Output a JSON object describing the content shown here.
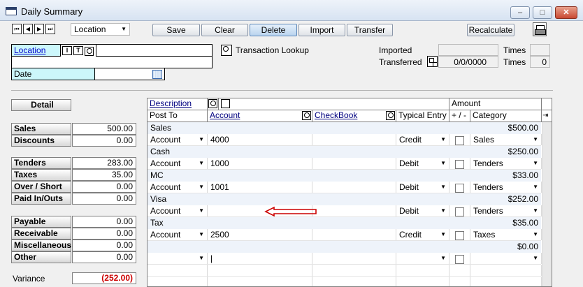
{
  "window": {
    "title": "Daily Summary",
    "min": "–",
    "max": "□",
    "close": "✕"
  },
  "toolbar": {
    "nav": [
      "⏮",
      "◀",
      "▶",
      "⏭"
    ],
    "view_select": "Location",
    "buttons": {
      "save": "Save",
      "clear": "Clear",
      "delete": "Delete",
      "import": "Import",
      "transfer": "Transfer"
    },
    "recalculate": "Recalculate"
  },
  "header": {
    "location_label": "Location",
    "location_value": "",
    "date_label": "Date",
    "date_value": "",
    "transaction_lookup": "Transaction Lookup",
    "imported_label": "Imported",
    "imported_value": "",
    "imported_times_label": "Times",
    "imported_times": "",
    "transferred_label": "Transferred",
    "transferred_value": "0/0/0000",
    "transferred_times_label": "Times",
    "transferred_times": "0"
  },
  "summary": {
    "detail_button": "Detail",
    "rows": [
      {
        "label": "Sales",
        "value": "500.00"
      },
      {
        "label": "Discounts",
        "value": "0.00"
      },
      {
        "label": "Tenders",
        "value": "283.00"
      },
      {
        "label": "Taxes",
        "value": "35.00"
      },
      {
        "label": "Over / Short",
        "value": "0.00"
      },
      {
        "label": "Paid In/Outs",
        "value": "0.00"
      },
      {
        "label": "Payable",
        "value": "0.00"
      },
      {
        "label": "Receivable",
        "value": "0.00"
      },
      {
        "label": "Miscellaneous",
        "value": "0.00"
      },
      {
        "label": "Other",
        "value": "0.00"
      }
    ],
    "variance_label": "Variance",
    "variance_value": "(252.00)",
    "variance_color": "#cc0000"
  },
  "grid": {
    "headers": {
      "description": "Description",
      "amount": "Amount",
      "post_to": "Post To",
      "account": "Account",
      "checkbook": "CheckBook",
      "typical_entry": "Typical Entry",
      "plus_minus": "+ / -",
      "category": "Category"
    },
    "groups": [
      {
        "description": "Sales",
        "amount": "$500.00",
        "post_to": "Account",
        "account": "4000",
        "checkbook": "",
        "entry": "Credit",
        "category": "Sales"
      },
      {
        "description": "Cash",
        "amount": "$250.00",
        "post_to": "Account",
        "account": "1000",
        "checkbook": "",
        "entry": "Debit",
        "category": "Tenders"
      },
      {
        "description": "MC",
        "amount": "$33.00",
        "post_to": "Account",
        "account": "1001",
        "checkbook": "",
        "entry": "Debit",
        "category": "Tenders"
      },
      {
        "description": "Visa",
        "amount": "$252.00",
        "post_to": "Account",
        "account": "",
        "checkbook": "",
        "entry": "Debit",
        "category": "Tenders"
      },
      {
        "description": "Tax",
        "amount": "$35.00",
        "post_to": "Account",
        "account": "2500",
        "checkbook": "",
        "entry": "Credit",
        "category": "Taxes"
      },
      {
        "description": "",
        "amount": "$0.00",
        "post_to": "",
        "account": "|",
        "checkbook": "",
        "entry": "",
        "category": ""
      }
    ],
    "arrow_color": "#cc0000"
  }
}
